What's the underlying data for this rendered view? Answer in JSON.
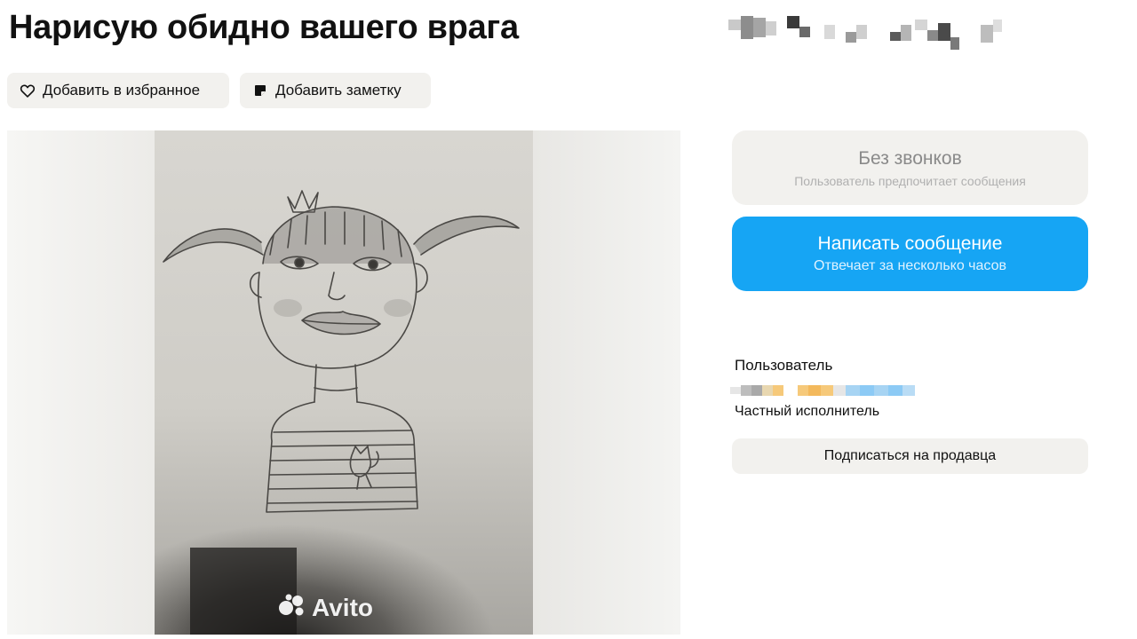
{
  "listing": {
    "title": "Нарисую обидно вашего врага"
  },
  "actions": {
    "favorite_label": "Добавить в избранное",
    "note_label": "Добавить заметку"
  },
  "gallery": {
    "watermark": "Avito"
  },
  "contact": {
    "no_calls_title": "Без звонков",
    "no_calls_subtitle": "Пользователь предпочитает сообщения",
    "message_title": "Написать сообщение",
    "message_subtitle": "Отвечает за несколько часов"
  },
  "seller": {
    "role": "Пользователь",
    "type": "Частный исполнитель",
    "subscribe_label": "Подписаться на продавца"
  },
  "colors": {
    "accent": "#16a5f4",
    "button_bg": "#f2f1ee"
  },
  "icons": {
    "favorite": "heart-icon",
    "note": "note-icon",
    "watermark": "avito-logo-icon"
  }
}
